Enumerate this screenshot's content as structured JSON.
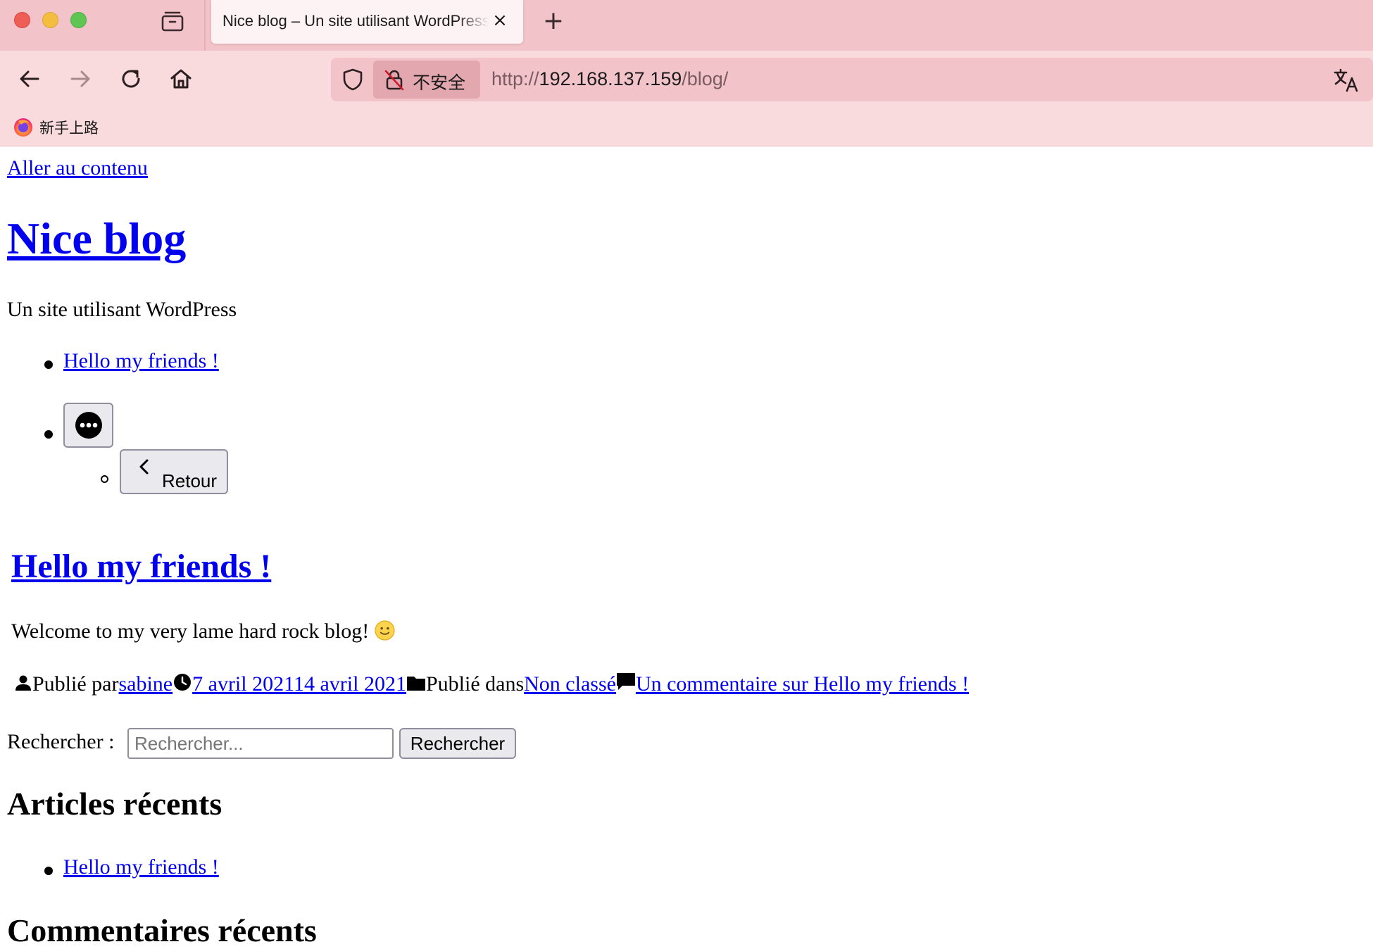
{
  "browser": {
    "tab_title": "Nice blog – Un site utilisant WordPress",
    "tab_close": "×",
    "new_tab": "+",
    "security_label": "不安全",
    "url_prefix": "http://",
    "url_host": "192.168.137.159",
    "url_path": "/blog/",
    "bookmark": "新手上路"
  },
  "page": {
    "skip_link": "Aller au contenu",
    "site_title": "Nice blog",
    "site_description": "Un site utilisant WordPress",
    "nav": {
      "items": [
        {
          "label": "Hello my friends !"
        }
      ],
      "back_label": "Retour"
    },
    "post": {
      "title": "Hello my friends !",
      "excerpt": "Welcome to my very lame hard rock blog!",
      "meta": {
        "published_by_label": "Publié par",
        "author": "sabine",
        "dates": "7 avril 202114 avril 2021",
        "published_in_label": "Publié dans",
        "category": "Non classé",
        "comments_link": "Un commentaire sur Hello my friends !"
      }
    },
    "search": {
      "label": "Rechercher :",
      "placeholder": "Rechercher...",
      "button": "Rechercher"
    },
    "recent_posts": {
      "heading": "Articles récents",
      "items": [
        {
          "label": "Hello my friends !"
        }
      ]
    },
    "recent_comments": {
      "heading": "Commentaires récents"
    }
  }
}
